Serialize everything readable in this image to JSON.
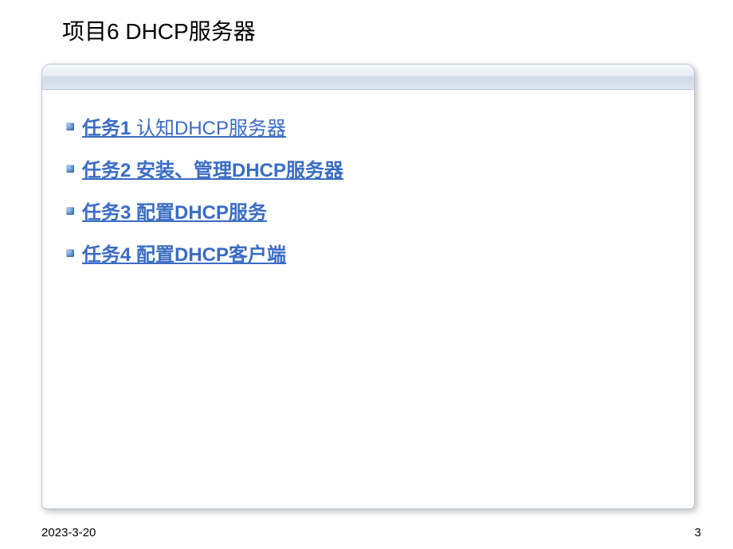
{
  "title": "项目6 DHCP服务器",
  "tasks": [
    {
      "prefix": "任务1 ",
      "rest": "认知DHCP服务器",
      "allBold": false
    },
    {
      "prefix": "任务2 ",
      "rest": "安装、管理DHCP服务器",
      "allBold": true
    },
    {
      "prefix": "任务3  ",
      "rest": "配置DHCP服务",
      "allBold": true
    },
    {
      "prefix": "任务4  ",
      "rest": "配置DHCP客户端",
      "allBold": true
    }
  ],
  "footer": {
    "date": "2023-3-20",
    "page": "3"
  },
  "colors": {
    "link": "#3a6cc4",
    "panel_border": "#b8c4d4"
  }
}
